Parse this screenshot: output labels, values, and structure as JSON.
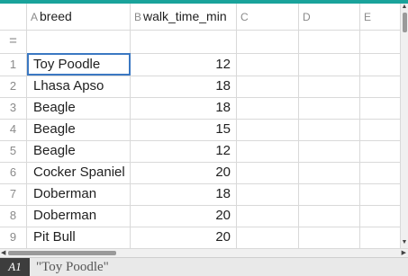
{
  "columns": [
    {
      "letter": "A",
      "name": "breed"
    },
    {
      "letter": "B",
      "name": "walk_time_min"
    },
    {
      "letter": "C",
      "name": ""
    },
    {
      "letter": "D",
      "name": ""
    },
    {
      "letter": "E",
      "name": ""
    }
  ],
  "formula_row_marker": "=",
  "rows": [
    {
      "num": "1",
      "breed": "Toy Poodle",
      "walk": "12"
    },
    {
      "num": "2",
      "breed": "Lhasa Apso",
      "walk": "18"
    },
    {
      "num": "3",
      "breed": "Beagle",
      "walk": "18"
    },
    {
      "num": "4",
      "breed": "Beagle",
      "walk": "15"
    },
    {
      "num": "5",
      "breed": "Beagle",
      "walk": "12"
    },
    {
      "num": "6",
      "breed": "Cocker Spaniel",
      "walk": "20"
    },
    {
      "num": "7",
      "breed": "Doberman",
      "walk": "18"
    },
    {
      "num": "8",
      "breed": "Doberman",
      "walk": "20"
    },
    {
      "num": "9",
      "breed": "Pit Bull",
      "walk": "20"
    }
  ],
  "status": {
    "cell_ref": "A1",
    "cell_value": "\"Toy Poodle\""
  },
  "colors": {
    "accent": "#1aa39b",
    "selection": "#3b78c2"
  },
  "icons": {
    "scroll_up": "▲",
    "scroll_down": "▼",
    "scroll_left": "◀",
    "scroll_right": "▶"
  }
}
